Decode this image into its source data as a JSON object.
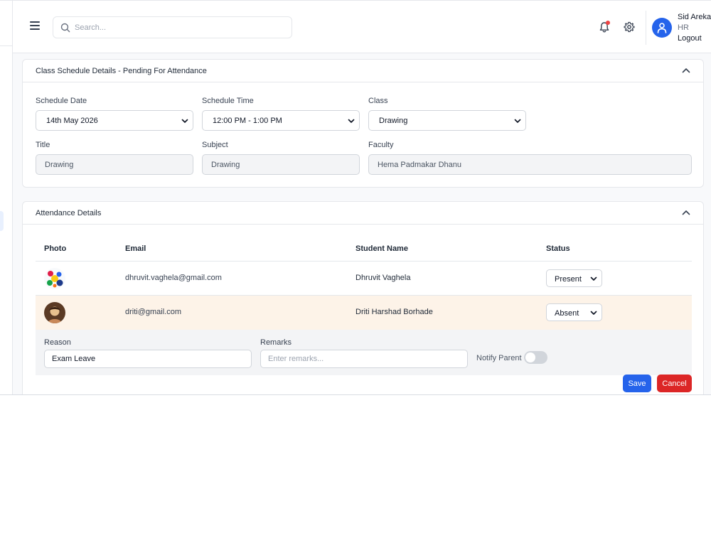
{
  "header": {
    "search_placeholder": "Search...",
    "user": {
      "name": "Sid Arekar",
      "role": "HR",
      "logout_label": "Logout"
    }
  },
  "schedule_card": {
    "title": "Class Schedule Details - Pending For Attendance",
    "fields": {
      "schedule_date": {
        "label": "Schedule Date",
        "value": "14th May 2026"
      },
      "schedule_time": {
        "label": "Schedule Time",
        "value": "12:00 PM - 1:00 PM"
      },
      "class": {
        "label": "Class",
        "value": "Drawing"
      },
      "title": {
        "label": "Title",
        "value": "Drawing"
      },
      "subject": {
        "label": "Subject",
        "value": "Drawing"
      },
      "faculty": {
        "label": "Faculty",
        "value": "Hema Padmakar Dhanu"
      }
    }
  },
  "attendance_card": {
    "title": "Attendance Details",
    "columns": {
      "photo": "Photo",
      "email": "Email",
      "student_name": "Student Name",
      "status": "Status"
    },
    "rows": [
      {
        "email": "dhruvit.vaghela@gmail.com",
        "student_name": "Dhruvit Vaghela",
        "status": "Present"
      },
      {
        "email": "driti@gmail.com",
        "student_name": "Driti Harshad Borhade",
        "status": "Absent"
      }
    ],
    "absent_details": {
      "reason_label": "Reason",
      "reason_value": "Exam Leave",
      "remarks_label": "Remarks",
      "remarks_placeholder": "Enter remarks...",
      "notify_label": "Notify Parent",
      "notify_on": false
    },
    "save_label": "Save",
    "cancel_label": "Cancel"
  },
  "colors": {
    "primary": "#2563eb",
    "danger": "#dc2626",
    "absent_row": "#fdf3e8",
    "notification_dot": "#ef4444"
  }
}
